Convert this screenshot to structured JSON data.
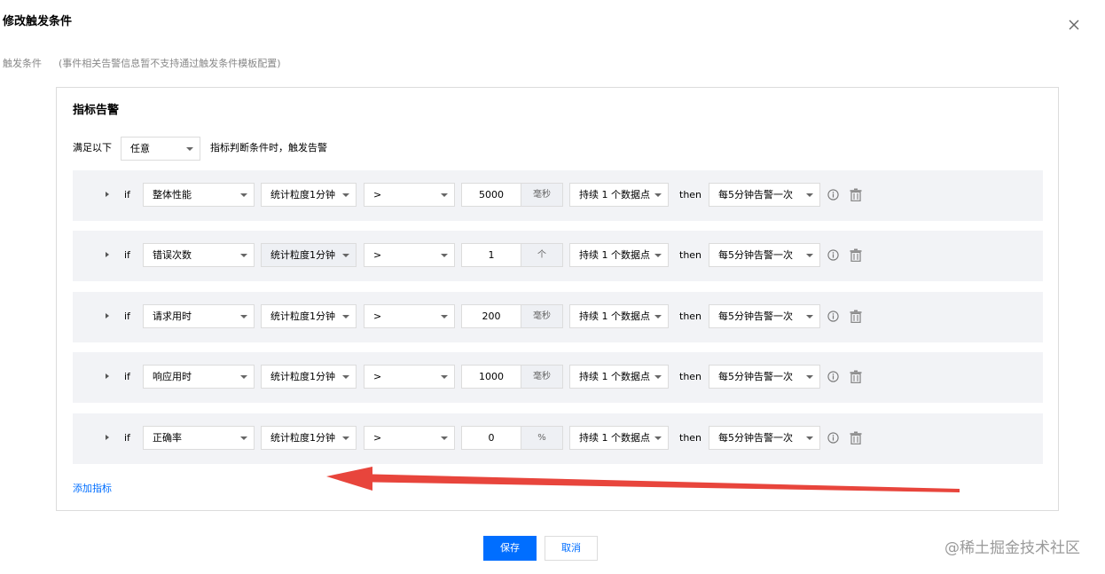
{
  "dialog": {
    "title": "修改触发条件"
  },
  "trigger": {
    "label": "触发条件",
    "note": "(事件相关告警信息暂不支持通过触发条件模板配置)"
  },
  "metric_alarm": {
    "title": "指标告警",
    "satisfy_prefix": "满足以下",
    "satisfy_value": "任意",
    "satisfy_suffix": "指标判断条件时，触发告警"
  },
  "rules": [
    {
      "if_label": "if",
      "metric": "整体性能",
      "granularity": "统计粒度1分钟",
      "granularity_disabled": false,
      "operator": ">",
      "threshold": "5000",
      "unit": "毫秒",
      "duration": "持续 1 个数据点",
      "then_label": "then",
      "frequency": "每5分钟告警一次"
    },
    {
      "if_label": "if",
      "metric": "错误次数",
      "granularity": "统计粒度1分钟",
      "granularity_disabled": true,
      "operator": ">",
      "threshold": "1",
      "unit": "个",
      "duration": "持续 1 个数据点",
      "then_label": "then",
      "frequency": "每5分钟告警一次"
    },
    {
      "if_label": "if",
      "metric": "请求用时",
      "granularity": "统计粒度1分钟",
      "granularity_disabled": false,
      "operator": ">",
      "threshold": "200",
      "unit": "毫秒",
      "duration": "持续 1 个数据点",
      "then_label": "then",
      "frequency": "每5分钟告警一次"
    },
    {
      "if_label": "if",
      "metric": "响应用时",
      "granularity": "统计粒度1分钟",
      "granularity_disabled": false,
      "operator": ">",
      "threshold": "1000",
      "unit": "毫秒",
      "duration": "持续 1 个数据点",
      "then_label": "then",
      "frequency": "每5分钟告警一次"
    },
    {
      "if_label": "if",
      "metric": "正确率",
      "granularity": "统计粒度1分钟",
      "granularity_disabled": false,
      "operator": ">",
      "threshold": "0",
      "unit": "%",
      "duration": "持续 1 个数据点",
      "then_label": "then",
      "frequency": "每5分钟告警一次"
    }
  ],
  "add_metric_label": "添加指标",
  "footer": {
    "save_label": "保存",
    "cancel_label": "取消"
  },
  "watermark": "@稀土掘金技术社区",
  "colors": {
    "primary": "#006eff",
    "row_background": "#f2f3f6",
    "annotation_arrow": "#e8453c"
  },
  "icons": {
    "close": "close-icon",
    "expand": "caret-right-icon",
    "info": "info-icon",
    "delete": "trash-icon",
    "dropdown": "chevron-down-icon"
  }
}
